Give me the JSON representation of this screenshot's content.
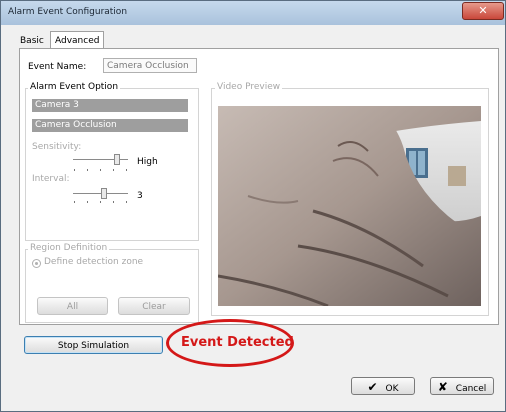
{
  "window": {
    "title": "Alarm Event Configuration",
    "close_glyph": "✕"
  },
  "tabs": {
    "basic": "Basic",
    "advanced": "Advanced"
  },
  "event_name": {
    "label": "Event Name:",
    "value": "Camera Occlusion"
  },
  "alarm_option": {
    "legend": "Alarm Event Option",
    "camera": "Camera 3",
    "event_type": "Camera Occlusion",
    "sensitivity_label": "Sensitivity:",
    "sensitivity_value": "High",
    "interval_label": "Interval:",
    "interval_value": "3"
  },
  "region": {
    "legend": "Region Definition",
    "radio_label": "Define detection zone",
    "all_button": "All",
    "clear_button": "Clear"
  },
  "video_preview": {
    "legend": "Video Preview"
  },
  "simulation_button": "Stop Simulation",
  "annotation": {
    "text": "Event Detected",
    "color": "#d41818"
  },
  "footer": {
    "ok": "OK",
    "cancel": "Cancel",
    "ok_icon": "✔",
    "cancel_icon": "✘"
  }
}
